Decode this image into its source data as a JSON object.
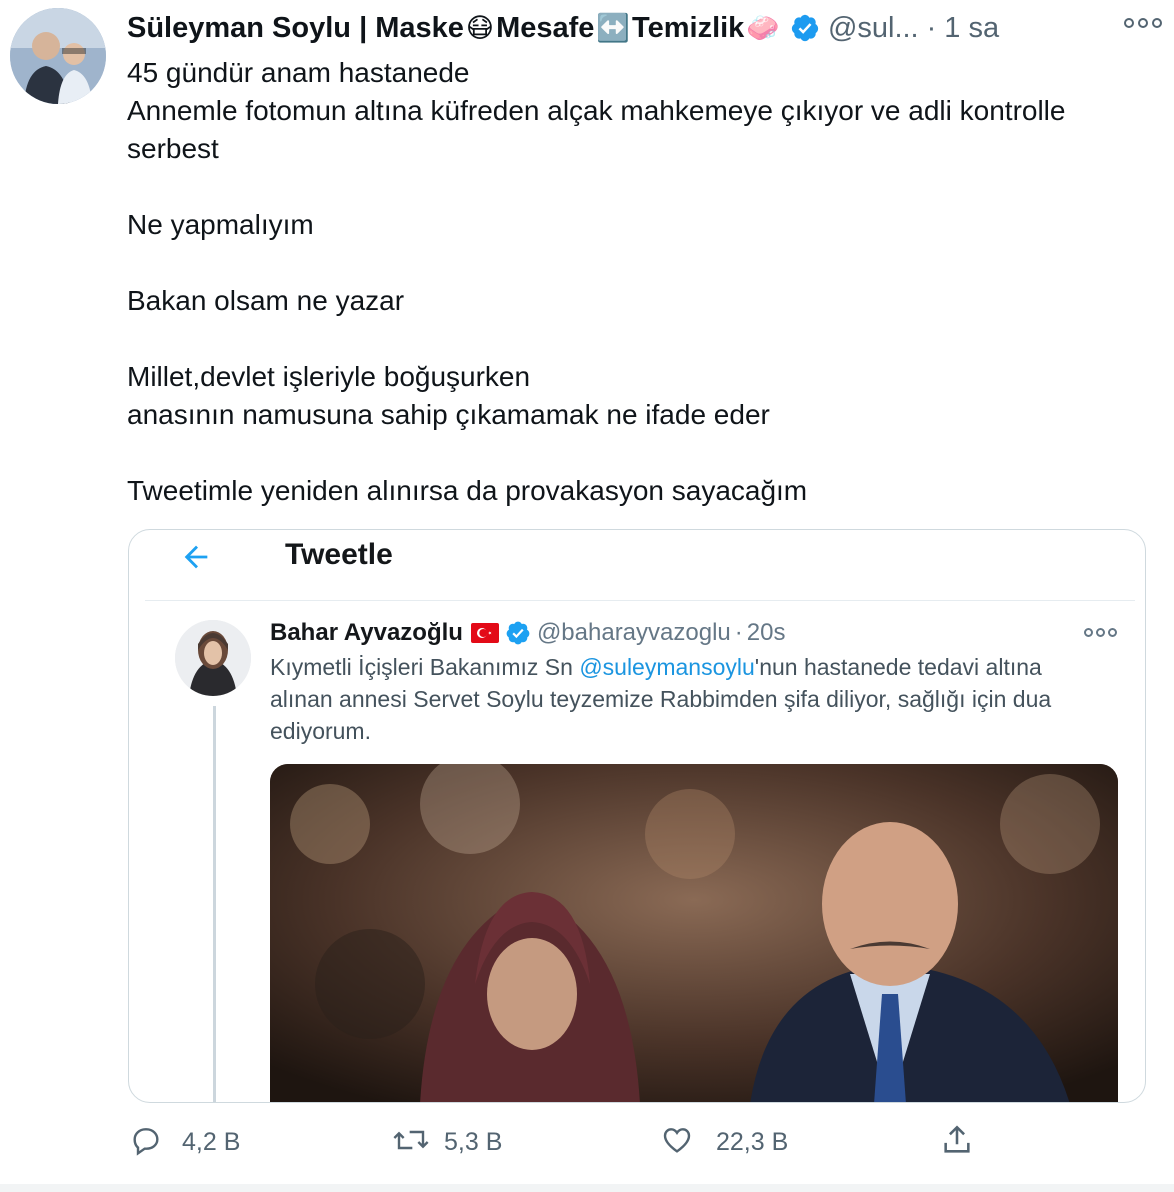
{
  "tweet": {
    "author_name": "Süleyman Soylu | Maske",
    "name_emoji_1": "😷",
    "name_part_2": " Mesafe",
    "name_emoji_2": "↔️",
    "name_part_3": " Temizlik",
    "name_emoji_3": "🧼",
    "handle": "@sul...",
    "separator": "·",
    "time": "1 sa",
    "text_lines": [
      "45 gündür anam hastanede",
      "Annemle fotomun altına küfreden alçak mahkemeye çıkıyor ve adli kontrolle serbest",
      "",
      "Ne yapmalıyım",
      "",
      "Bakan olsam ne yazar",
      "",
      "Millet,devlet işleriyle boğuşurken",
      "anasının namusuna sahip çıkamamak ne ifade eder",
      "",
      "Tweetimle yeniden alınırsa da provakasyon sayacağım"
    ]
  },
  "quoted_screenshot": {
    "title": "Tweetle",
    "author_name": "Bahar Ayvazoğlu",
    "handle": "@baharayvazoglu",
    "separator": "·",
    "time": "20s",
    "text_before_mention": "Kıymetli İçişleri Bakanımız Sn ",
    "mention": "@suleymansoylu",
    "text_after_mention": "'nun hastanede tedavi altına alınan annesi Servet Soylu teyzemize Rabbimden şifa diliyor, sağlığı için dua ediyorum."
  },
  "actions": {
    "reply_count": "4,2 B",
    "retweet_count": "5,3 B",
    "like_count": "22,3 B"
  },
  "colors": {
    "verified": "#1d9bf0",
    "secondary_text": "#536471",
    "link": "#1b95e0",
    "border": "#cfd9de"
  },
  "icons": [
    "verified-badge-icon",
    "more-options-icon",
    "back-arrow-icon",
    "turkey-flag-icon",
    "reply-icon",
    "retweet-icon",
    "like-icon",
    "share-icon"
  ]
}
